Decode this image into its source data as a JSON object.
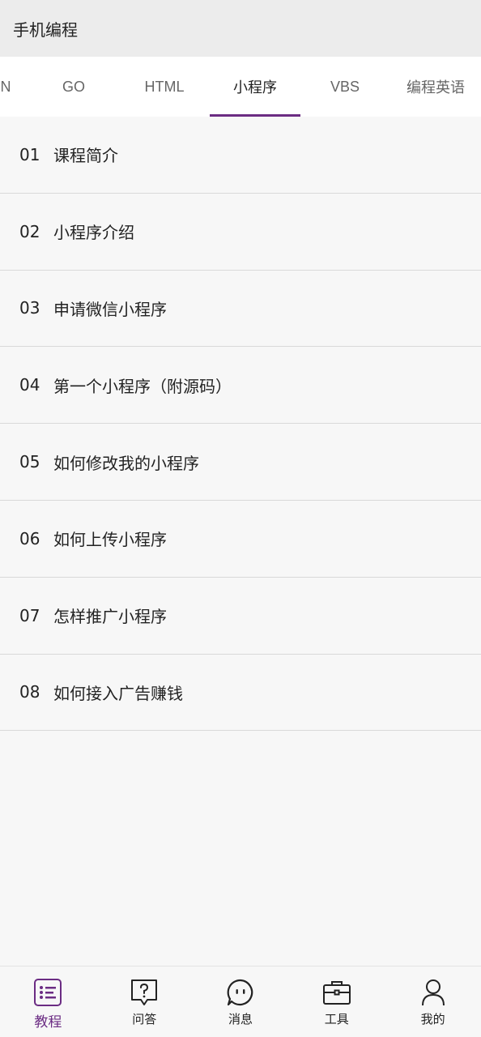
{
  "app": {
    "title": "手机编程"
  },
  "tabs": [
    {
      "label": "ON"
    },
    {
      "label": "GO"
    },
    {
      "label": "HTML"
    },
    {
      "label": "小程序"
    },
    {
      "label": "VBS"
    },
    {
      "label": "编程英语"
    }
  ],
  "active_tab": "小程序",
  "lessons": [
    {
      "num": "01",
      "title": "课程简介"
    },
    {
      "num": "02",
      "title": "小程序介绍"
    },
    {
      "num": "03",
      "title": "申请微信小程序"
    },
    {
      "num": "04",
      "title": "第一个小程序（附源码）"
    },
    {
      "num": "05",
      "title": "如何修改我的小程序"
    },
    {
      "num": "06",
      "title": "如何上传小程序"
    },
    {
      "num": "07",
      "title": "怎样推广小程序"
    },
    {
      "num": "08",
      "title": "如何接入广告赚钱"
    }
  ],
  "bottom_nav": [
    {
      "label": "教程",
      "icon": "list-icon",
      "active": true
    },
    {
      "label": "问答",
      "icon": "question-bubble-icon",
      "active": false
    },
    {
      "label": "消息",
      "icon": "chat-icon",
      "active": false
    },
    {
      "label": "工具",
      "icon": "toolbox-icon",
      "active": false
    },
    {
      "label": "我的",
      "icon": "user-icon",
      "active": false
    }
  ],
  "colors": {
    "accent": "#6b2c83",
    "app_bar_bg": "#ececec",
    "page_bg": "#f7f7f7",
    "tab_bar_bg": "#ffffff",
    "divider": "#d9d9d9"
  }
}
